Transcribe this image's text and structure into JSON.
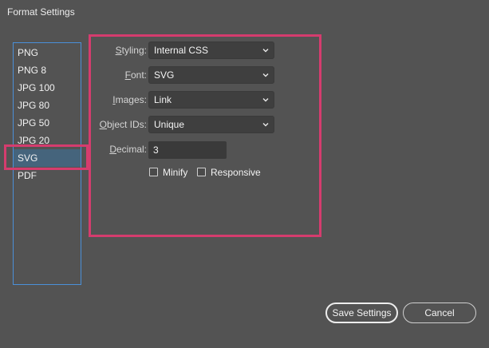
{
  "window": {
    "title": "Format Settings"
  },
  "formats": {
    "items": [
      "PNG",
      "PNG 8",
      "JPG 100",
      "JPG 80",
      "JPG 50",
      "JPG 20",
      "SVG",
      "PDF"
    ],
    "selected": "SVG"
  },
  "settings": {
    "styling": {
      "label_u": "S",
      "label_rest": "tyling:",
      "value": "Internal CSS"
    },
    "font": {
      "label_u": "F",
      "label_rest": "ont:",
      "value": "SVG"
    },
    "images": {
      "label_u": "I",
      "label_rest": "mages:",
      "value": "Link"
    },
    "object_ids": {
      "label_u": "O",
      "label_rest": "bject IDs:",
      "value": "Unique"
    },
    "decimal": {
      "label_u": "D",
      "label_rest": "ecimal:",
      "value": "3"
    },
    "minify": {
      "label": "Minify",
      "checked": false
    },
    "responsive": {
      "label": "Responsive",
      "checked": false
    }
  },
  "buttons": {
    "save": "Save Settings",
    "cancel": "Cancel"
  },
  "colors": {
    "background": "#535353",
    "selection": "#45647c",
    "list_border": "#4a90d9",
    "annotation": "#d53c6e"
  }
}
